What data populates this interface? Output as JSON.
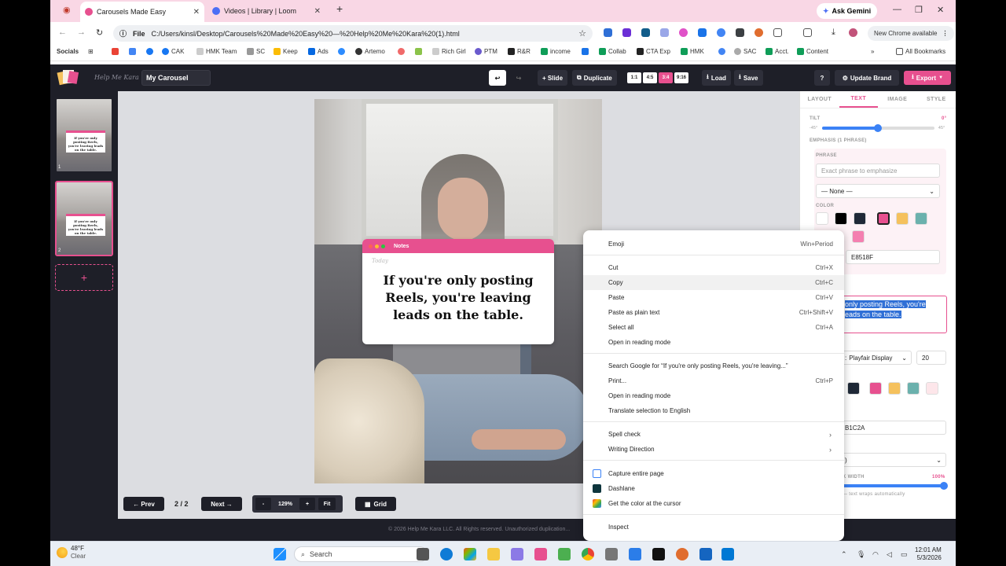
{
  "tabs": [
    {
      "title": "Carousels Made Easy",
      "color": "#e7508f"
    },
    {
      "title": "Videos | Library | Loom",
      "color": "#4b6ef5"
    }
  ],
  "gemini": "Ask Gemini",
  "address": {
    "label": "File",
    "url": "C:/Users/kinsl/Desktop/Carousels%20Made%20Easy%20—%20Help%20Me%20Kara%20(1).html"
  },
  "new_chrome": "New Chrome available",
  "bookmarks": {
    "socials": "Socials",
    "items": [
      "CAK",
      "HMK Team",
      "SC",
      "Keep",
      "Ads",
      "Artemo",
      "Rich Girl",
      "PTM",
      "R&R",
      "income",
      "Collab",
      "CTA Exp",
      "HMK",
      "SAC",
      "Acct.",
      "Content"
    ],
    "all": "All Bookmarks"
  },
  "app": {
    "brand": "Help Me Kara",
    "project": "My Carousel",
    "slide_btn": "+ Slide",
    "duplicate_btn": "Duplicate",
    "ratios": [
      "1:1",
      "4:5",
      "3:4",
      "9:16"
    ],
    "load_btn": "Load",
    "save_btn": "Save",
    "help_btn": "?",
    "update_brand": "Update Brand",
    "export": "Export"
  },
  "slide": {
    "notes_title": "Notes",
    "today": "Today",
    "text": "If you're only posting Reels, you're leaving leads on the table."
  },
  "controls": {
    "prev": "← Prev",
    "page": "2 / 2",
    "next": "Next →",
    "minus": "-",
    "zoom": "129%",
    "plus": "+",
    "fit": "Fit",
    "grid": "Grid"
  },
  "right": {
    "tabs": [
      "LAYOUT",
      "TEXT",
      "IMAGE",
      "STYLE"
    ],
    "tilt_label": "TILT",
    "tilt_value": "0°",
    "tilt_min": "-45°",
    "tilt_max": "45°",
    "emphasis_label": "EMPHASIS (1 PHRASE)",
    "phrase_label": "PHRASE",
    "phrase_placeholder": "Exact phrase to emphasize",
    "none_option": "— None —",
    "color_label": "COLOR",
    "hex1": "E8518F",
    "selected_text_1": "only posting Reels, you're",
    "selected_text_2": "eads on the table.",
    "font": "Playfair Display",
    "size": "20",
    "hex2": "B1C2A",
    "width_label": "K WIDTH",
    "width_value": "100%",
    "wrap_note": "— text wraps automatically"
  },
  "swatches1": [
    "#ffffff",
    "#000000",
    "#1f2937",
    "#e7508f",
    "#f5c15d",
    "#6bb1ad",
    "#f47fb0"
  ],
  "swatches2": [
    "#1f2937",
    "#e7508f",
    "#f5c15d",
    "#6bb1ad",
    "#fde6ea"
  ],
  "context_menu": [
    {
      "label": "Emoji",
      "shortcut": "Win+Period"
    },
    {
      "label": "Cut",
      "shortcut": "Ctrl+X"
    },
    {
      "label": "Copy",
      "shortcut": "Ctrl+C"
    },
    {
      "label": "Paste",
      "shortcut": "Ctrl+V"
    },
    {
      "label": "Paste as plain text",
      "shortcut": "Ctrl+Shift+V"
    },
    {
      "label": "Select all",
      "shortcut": "Ctrl+A"
    },
    {
      "label": "Open in reading mode",
      "shortcut": ""
    },
    {
      "label": "Search Google for “If you're only posting Reels, you're leaving...”",
      "shortcut": ""
    },
    {
      "label": "Print...",
      "shortcut": "Ctrl+P"
    },
    {
      "label": "Open in reading mode",
      "shortcut": ""
    },
    {
      "label": "Translate selection to English",
      "shortcut": ""
    },
    {
      "label": "Spell check",
      "shortcut": ""
    },
    {
      "label": "Writing Direction",
      "shortcut": ""
    },
    {
      "label": "Capture entire page",
      "shortcut": ""
    },
    {
      "label": "Dashlane",
      "shortcut": ""
    },
    {
      "label": "Get the color at the cursor",
      "shortcut": ""
    },
    {
      "label": "Inspect",
      "shortcut": ""
    }
  ],
  "copyright": "© 2026 Help Me Kara LLC. All Rights reserved. Unauthorized duplication...",
  "taskbar": {
    "temp": "48°F",
    "condition": "Clear",
    "search": "Search",
    "time": "12:01 AM",
    "date": "5/3/2026"
  }
}
